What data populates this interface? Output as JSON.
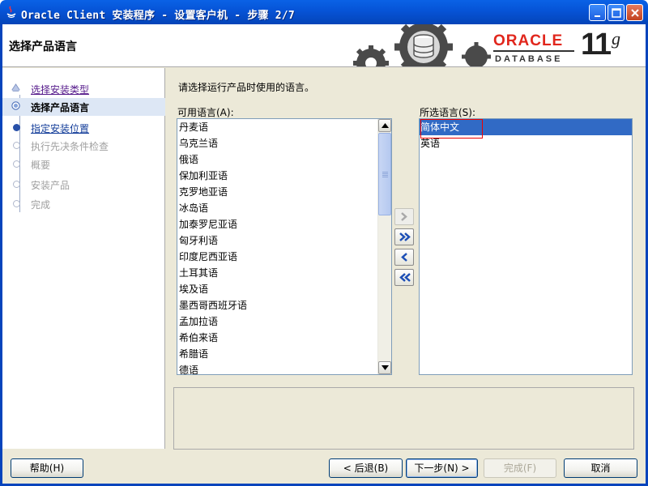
{
  "window": {
    "title": "Oracle Client 安装程序 - 设置客户机 - 步骤 2/7"
  },
  "header": {
    "page_title": "选择产品语言",
    "logo": {
      "brand": "ORACLE",
      "product": "DATABASE",
      "version": "11",
      "suffix": "g",
      "brand_color": "#e1261c"
    }
  },
  "steps": [
    {
      "label": "选择安装类型",
      "state": "done"
    },
    {
      "label": "选择产品语言",
      "state": "active"
    },
    {
      "label": "指定安装位置",
      "state": "link"
    },
    {
      "label": "执行先决条件检查",
      "state": "disabled"
    },
    {
      "label": "概要",
      "state": "disabled"
    },
    {
      "label": "安装产品",
      "state": "disabled"
    },
    {
      "label": "完成",
      "state": "disabled"
    }
  ],
  "main": {
    "instruction": "请选择运行产品时使用的语言。",
    "available_label": "可用语言(A):",
    "selected_label": "所选语言(S):",
    "available_languages": [
      "丹麦语",
      "乌克兰语",
      "俄语",
      "保加利亚语",
      "克罗地亚语",
      "冰岛语",
      "加泰罗尼亚语",
      "匈牙利语",
      "印度尼西亚语",
      "土耳其语",
      "埃及语",
      "墨西哥西班牙语",
      "孟加拉语",
      "希伯来语",
      "希腊语",
      "德语"
    ],
    "selected_languages": [
      "简体中文",
      "英语"
    ],
    "selected_index": 0
  },
  "footer": {
    "help": "帮助(H)",
    "back": "< 后退(B)",
    "next": "下一步(N) >",
    "finish": "完成(F)",
    "cancel": "取消"
  },
  "colors": {
    "selection": "#316ac5",
    "titlebar": "#0653d6",
    "dialog_bg": "#ece9d8"
  }
}
